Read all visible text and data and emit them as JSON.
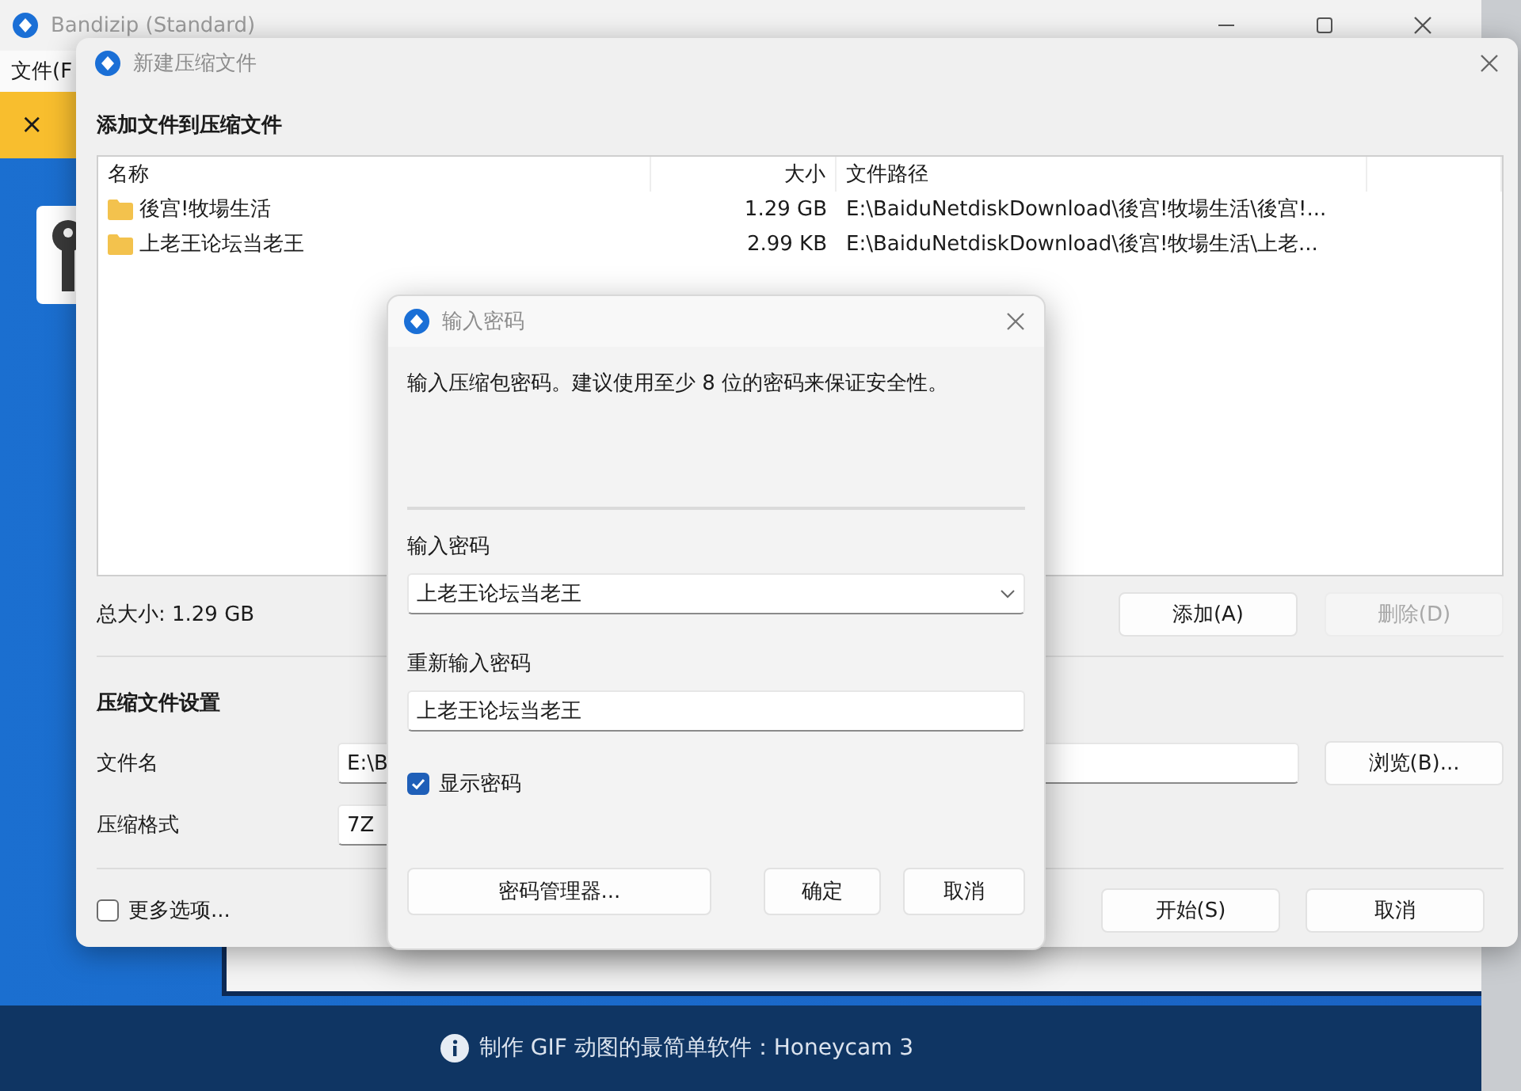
{
  "main_window": {
    "title": "Bandizip (Standard)",
    "menu": [
      "文件(F"
    ],
    "banner": {
      "close_glyph": "×"
    }
  },
  "compress_dialog": {
    "title": "新建压缩文件",
    "heading": "添加文件到压缩文件",
    "file_list": {
      "columns": [
        "名称",
        "大小",
        "文件路径"
      ],
      "rows": [
        {
          "name": "後宫!牧場生活",
          "size": "1.29 GB",
          "path": "E:\\BaiduNetdiskDownload\\後宫!牧場生活\\後宫!..."
        },
        {
          "name": "上老王论坛当老王",
          "size": "2.99 KB",
          "path": "E:\\BaiduNetdiskDownload\\後宫!牧場生活\\上老..."
        }
      ]
    },
    "total_size": "总大小: 1.29 GB",
    "list_buttons": [
      {
        "label": "添加(A)",
        "disabled": false
      },
      {
        "label": "删除(D)",
        "disabled": true
      }
    ],
    "settings_heading": "压缩文件设置",
    "settings": [
      {
        "label": "文件名",
        "value": "E:\\B",
        "button": "浏览(B)..."
      },
      {
        "label": "压缩格式",
        "value": "7Z"
      }
    ],
    "more_options": {
      "label": "更多选项...",
      "checked": false
    },
    "footer_buttons": [
      {
        "label": "开始(S)",
        "disabled": false
      },
      {
        "label": "取消",
        "disabled": false
      }
    ]
  },
  "password_dialog": {
    "title": "输入密码",
    "description": "输入压缩包密码。建议使用至少 8 位的密码来保证安全性。",
    "password": {
      "label": "输入密码",
      "value": "上老王论坛当老王"
    },
    "confirm": {
      "label": "重新输入密码",
      "value": "上老王论坛当老王"
    },
    "show_password": {
      "label": "显示密码",
      "checked": true
    },
    "manager_button": "密码管理器...",
    "buttons": [
      {
        "label": "确定",
        "disabled": false
      },
      {
        "label": "取消",
        "disabled": false
      }
    ]
  },
  "status_bar": {
    "text": "制作 GIF 动图的最简单软件：Honeycam 3"
  }
}
